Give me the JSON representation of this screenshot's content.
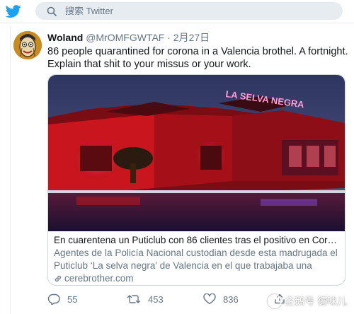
{
  "search": {
    "placeholder": "搜索 Twitter"
  },
  "tweet": {
    "name": "Woland",
    "handle": "@MrOMFGWTAF",
    "separator": "·",
    "date": "2月27日",
    "text": "86 people quarantined for corona in a Valencia brothel. A fortnight. Explain that shit to your missus or your work.",
    "card": {
      "title": "En cuarentena un Puticlub con 86 clientes tras el positivo en Coro...",
      "description": "Agentes de la Policía Nacional custodian desde esta madrugada el Puticlub ‘La selva negra’ de Valencia en el que trabajaba una chica...",
      "domain": "cerebrother.com",
      "sign_text": "LA SELVA NEGRA"
    },
    "actions": {
      "replies": "55",
      "retweets": "453",
      "likes": "836"
    }
  },
  "watermark": {
    "text": "企鹅号 德味儿"
  },
  "colors": {
    "twitter_blue": "#1da1f2",
    "text_gray": "#657786",
    "border": "#e6ecf0"
  }
}
